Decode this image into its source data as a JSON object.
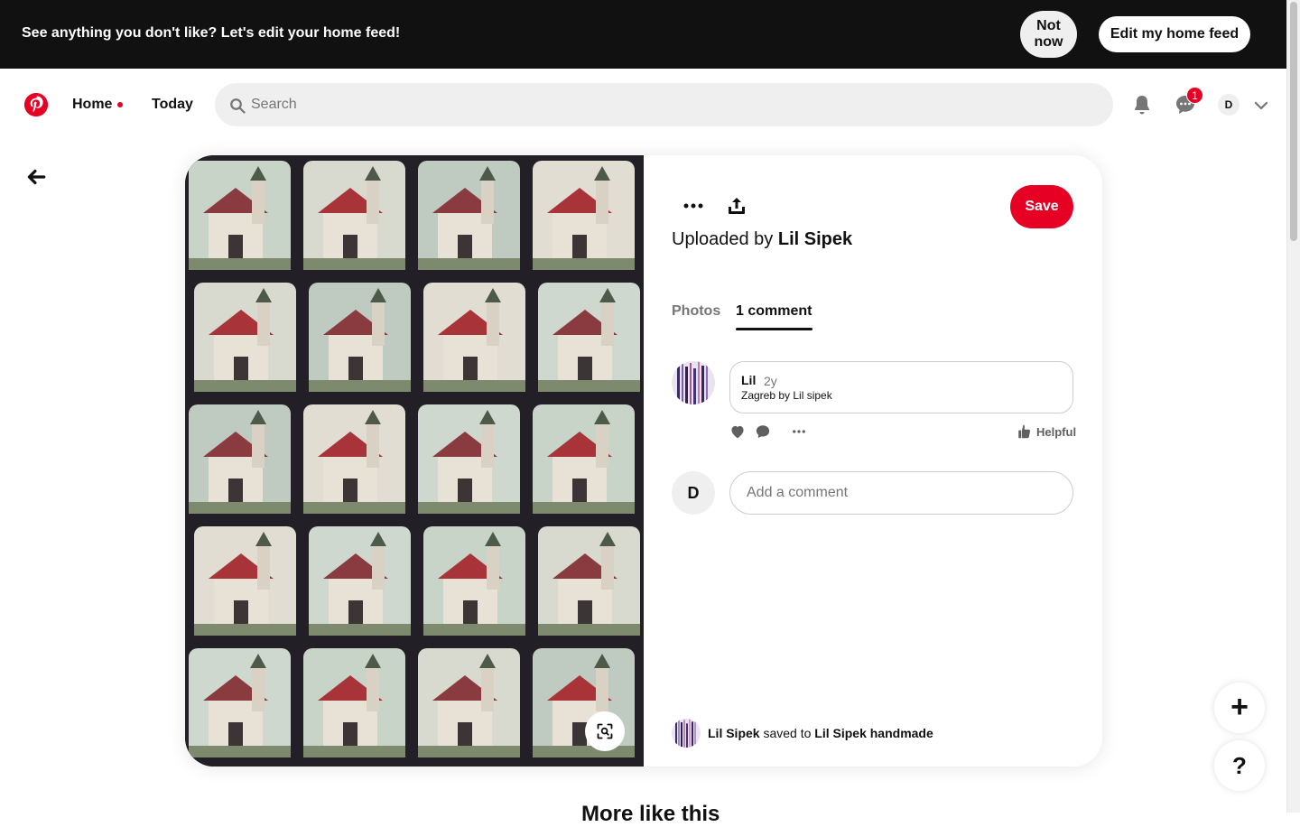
{
  "banner": {
    "message": "See anything you don't like? Let's edit your home feed!",
    "not_now_label": "Not\nnow",
    "edit_feed_label": "Edit my home feed"
  },
  "header": {
    "logo_icon": "pinterest-logo-icon",
    "nav": {
      "home_label": "Home",
      "today_label": "Today"
    },
    "search": {
      "placeholder": "Search"
    },
    "messages_badge": "1",
    "profile_initial": "D",
    "brand_color": "#e60023"
  },
  "pin": {
    "actions": {
      "save_label": "Save"
    },
    "uploaded_prefix": "Uploaded by ",
    "uploader_name": "Lil Sipek",
    "tabs": [
      {
        "label": "Photos",
        "active": false
      },
      {
        "label": "1 comment",
        "active": true
      }
    ],
    "comment": {
      "user": "Lil",
      "time": "2y",
      "text": "Zagreb by Lil sipek",
      "helpful_label": "Helpful"
    },
    "add_comment": {
      "avatar_initial": "D",
      "placeholder": "Add a comment"
    },
    "saved_by": {
      "user": "Lil Sipek",
      "verb": "saved to",
      "board": "Lil Sipek handmade"
    }
  },
  "floating": {
    "add_label": "+",
    "help_label": "?"
  },
  "more_like_this": "More like this"
}
